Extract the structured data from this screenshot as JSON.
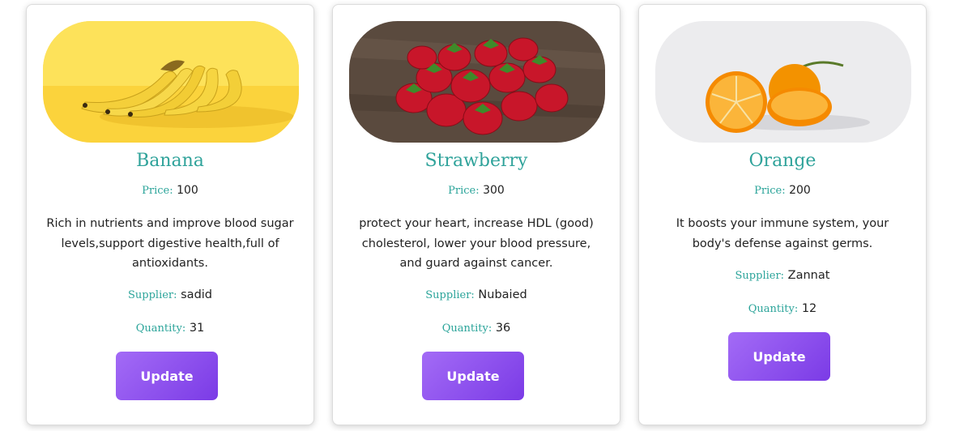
{
  "labels": {
    "price": "Price:",
    "supplier": "Supplier:",
    "quantity": "Quantity:",
    "update": "Update"
  },
  "products": [
    {
      "name": "Banana",
      "price": "100",
      "description": "Rich in nutrients and improve blood sugar levels,support digestive health,full of antioxidants.",
      "supplier": "sadid",
      "quantity": "31",
      "image_icon": "banana-image"
    },
    {
      "name": "Strawberry",
      "price": "300",
      "description": "protect your heart, increase HDL (good) cholesterol, lower your blood pressure, and guard against cancer.",
      "supplier": "Nubaied",
      "quantity": "36",
      "image_icon": "strawberry-image"
    },
    {
      "name": "Orange",
      "price": "200",
      "description": "It boosts your immune system, your body's defense against germs.",
      "supplier": "Zannat",
      "quantity": "12",
      "image_icon": "orange-image"
    }
  ],
  "colors": {
    "accent": "#30a39b",
    "button_start": "#a36bf6",
    "button_end": "#7b3be6"
  }
}
